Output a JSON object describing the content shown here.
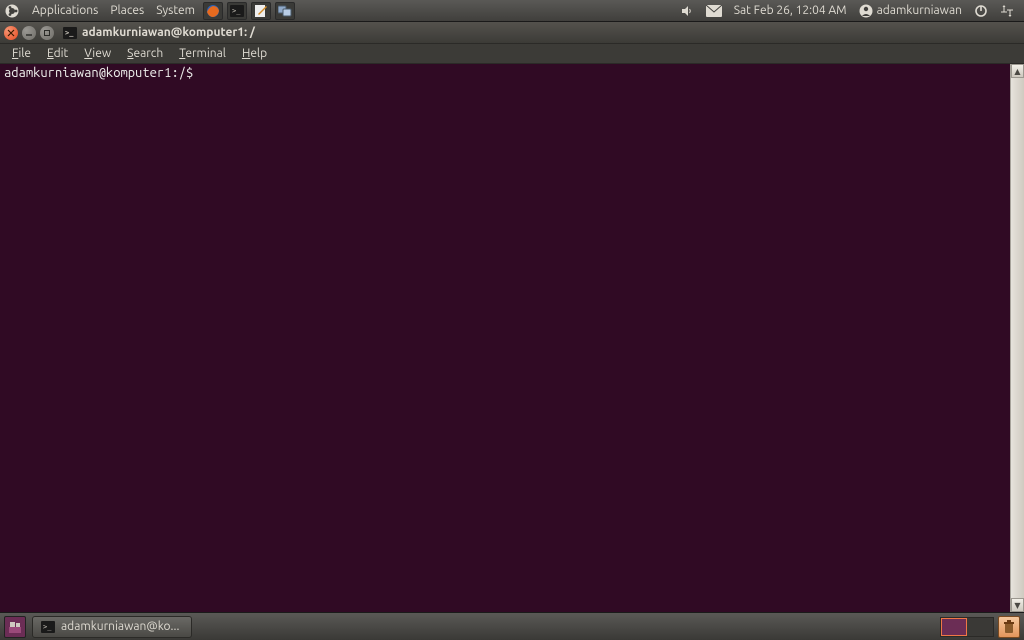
{
  "top_panel": {
    "menus": [
      "Applications",
      "Places",
      "System"
    ],
    "datetime": "Sat Feb 26, 12:04 AM",
    "username": "adamkurniawan"
  },
  "window": {
    "title": "adamkurniawan@komputer1: /"
  },
  "menubar": {
    "file": "File",
    "edit": "Edit",
    "view": "View",
    "search": "Search",
    "terminal": "Terminal",
    "help": "Help"
  },
  "terminal": {
    "prompt": "adamkurniawan@komputer1:/$ "
  },
  "bottom_panel": {
    "task_label": "adamkurniawan@ko..."
  }
}
